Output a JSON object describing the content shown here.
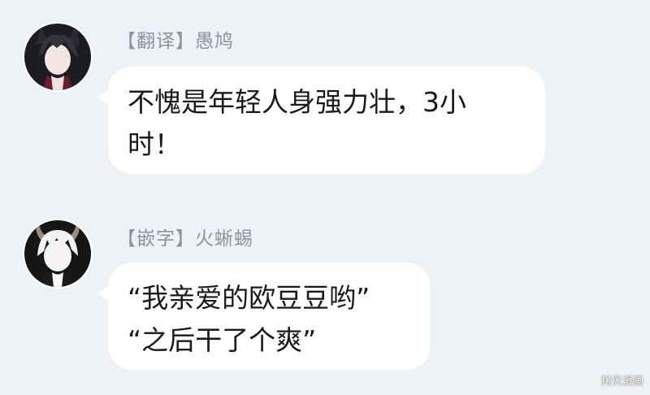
{
  "messages": [
    {
      "sender": "【翻译】愚鸠",
      "lines": [
        "不愧是年轻人身强力壮，3小",
        "时！"
      ]
    },
    {
      "sender": "【嵌字】火蜥蜴",
      "lines": [
        "“我亲爱的欧豆豆哟”",
        "“之后干了个爽”"
      ]
    }
  ],
  "watermark": "拷贝漫画",
  "colors": {
    "background": "#eef1f6",
    "bubble": "#ffffff",
    "sender": "#8e929a"
  }
}
